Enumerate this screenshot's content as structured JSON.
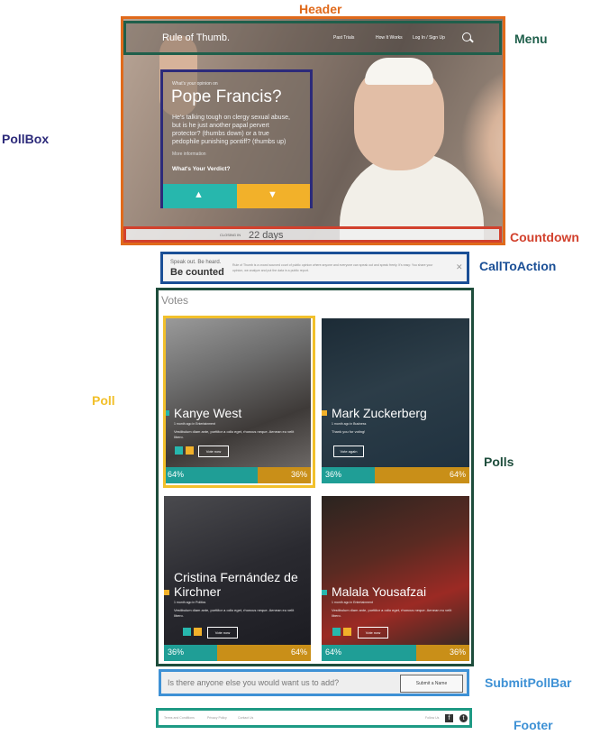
{
  "annotations": {
    "header": {
      "text": "Header",
      "color": "#e06a1b"
    },
    "menu": {
      "text": "Menu",
      "color": "#1f5f4b"
    },
    "pollbox": {
      "text": "PollBox",
      "color": "#2c2a7a"
    },
    "countdown": {
      "text": "Countdown",
      "color": "#d2412d"
    },
    "cta": {
      "text": "CallToAction",
      "color": "#1a4f96"
    },
    "poll": {
      "text": "Poll",
      "color": "#f2c02b"
    },
    "polls": {
      "text": "Polls",
      "color": "#1e4d3c"
    },
    "submit": {
      "text": "SubmitPollBar",
      "color": "#3e91d5"
    },
    "footer": {
      "text": "Footer",
      "color": "#3e91d5"
    }
  },
  "menu": {
    "brand": "Rule of Thumb.",
    "links": [
      "Past Trials",
      "How It Works",
      "Log In / Sign Up"
    ]
  },
  "pollbox": {
    "kicker": "What's your opinion on",
    "name": "Pope Francis?",
    "body": "He's talking tough on clergy sexual abuse, but is he just another papal pervert protector? (thumbs down) or a true pedophile punishing pontiff? (thumbs up)",
    "more": "More information",
    "verdict": "What's Your Verdict?"
  },
  "countdown": {
    "label": "CLOSING IN",
    "value": "22 days"
  },
  "cta": {
    "speak": "Speak out. Be heard.",
    "counted": "Be counted",
    "text": "Rule of Thumb is a crowd sourced court of public opinion where anyone and everyone can speak out and speak freely. It's easy: You share your opinion, we analyze and put the data in a public report."
  },
  "polls": {
    "votes_label": "Votes",
    "vote_now": "Vote now",
    "vote_again": "Vote again",
    "items": [
      {
        "name": "Kanye West",
        "meta": "1 month ago in Entertainment",
        "body": "Vestibulum diam ante, porttitor a odio eget, rhoncus neque. Aenean eu velit libero.",
        "up": 64,
        "down": 36,
        "up_label": "64%",
        "down_label": "36%",
        "flag": "up",
        "action": "Vote now"
      },
      {
        "name": "Mark Zuckerberg",
        "meta": "1 month ago in Business",
        "body": "Thank you for voting!",
        "up": 36,
        "down": 64,
        "up_label": "36%",
        "down_label": "64%",
        "flag": "down",
        "action": "Vote again"
      },
      {
        "name": "Cristina Fernández de Kirchner",
        "meta": "1 month ago in Politics",
        "body": "Vestibulum diam ante, porttitor a odio eget, rhoncus neque. Aenean eu velit libero.",
        "up": 36,
        "down": 64,
        "up_label": "36%",
        "down_label": "64%",
        "flag": "down",
        "action": "Vote now"
      },
      {
        "name": "Malala Yousafzai",
        "meta": "1 month ago in Entertainment",
        "body": "Vestibulum diam ante, porttitor a odio eget, rhoncus neque. Aenean eu velit libero.",
        "up": 64,
        "down": 36,
        "up_label": "64%",
        "down_label": "36%",
        "flag": "up",
        "action": "Vote now"
      }
    ]
  },
  "submit": {
    "question": "Is there anyone else you would want us to add?",
    "button": "Submit a Name"
  },
  "footer": {
    "links": [
      "Terms and Conditions",
      "Privacy Policy",
      "Contact Us"
    ],
    "follow": "Follow Us"
  },
  "colors": {
    "up": "#27b7ad",
    "down": "#e8a523",
    "up_bar": "#1f9e96",
    "down_bar": "#c98f18"
  }
}
